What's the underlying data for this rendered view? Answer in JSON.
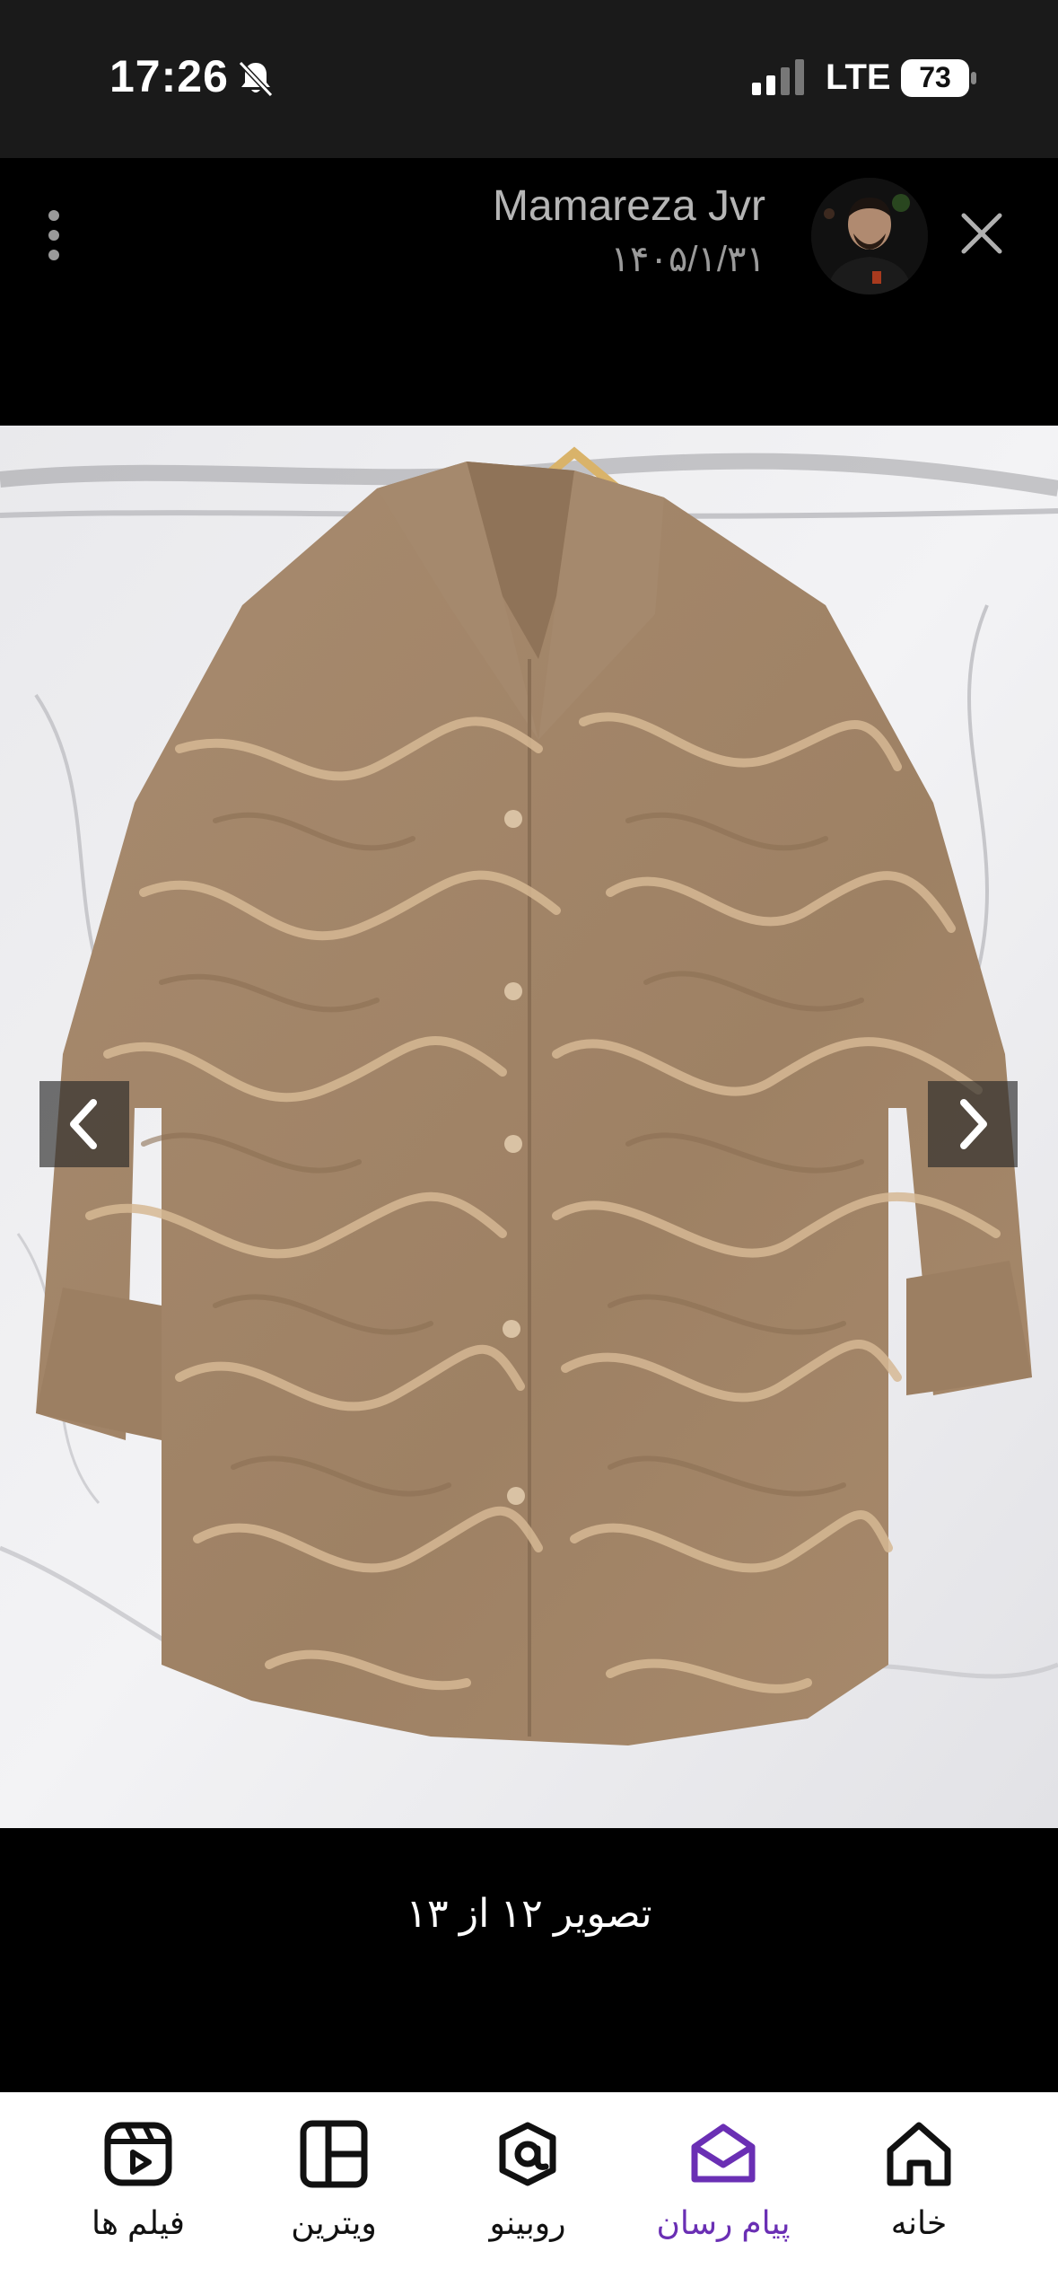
{
  "status_bar": {
    "time": "17:26",
    "network": "LTE",
    "battery": "73"
  },
  "header": {
    "author_name": "Mamareza Jvr",
    "date": "۱۴۰۵/۱/۳۱"
  },
  "viewer": {
    "caption": "تصویر ۱۲ از ۱۳"
  },
  "bottom_nav": {
    "items": [
      {
        "label": "فیلم ها",
        "icon": "video-reel-icon"
      },
      {
        "label": "ویترین",
        "icon": "showcase-grid-icon"
      },
      {
        "label": "روبینو",
        "icon": "at-sign-icon"
      },
      {
        "label": "پیام رسان",
        "icon": "messenger-envelope-icon"
      },
      {
        "label": "خانه",
        "icon": "home-icon"
      }
    ],
    "active_index": 3
  },
  "colors": {
    "accent": "#6a2fb4",
    "shirt": "#a3866a",
    "background": "#000000"
  }
}
